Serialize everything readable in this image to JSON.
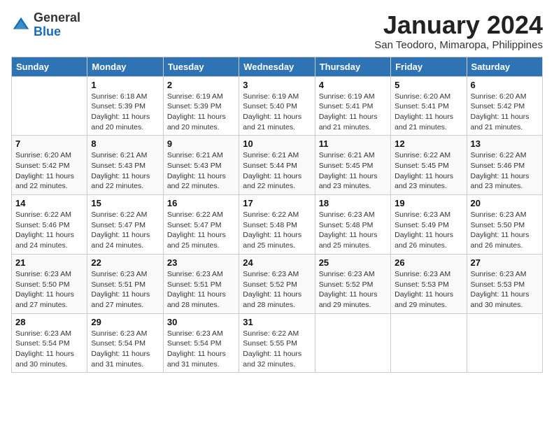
{
  "logo": {
    "general": "General",
    "blue": "Blue"
  },
  "title": "January 2024",
  "location": "San Teodoro, Mimaropa, Philippines",
  "days_header": [
    "Sunday",
    "Monday",
    "Tuesday",
    "Wednesday",
    "Thursday",
    "Friday",
    "Saturday"
  ],
  "weeks": [
    [
      {
        "num": "",
        "info": ""
      },
      {
        "num": "1",
        "info": "Sunrise: 6:18 AM\nSunset: 5:39 PM\nDaylight: 11 hours and 20 minutes."
      },
      {
        "num": "2",
        "info": "Sunrise: 6:19 AM\nSunset: 5:39 PM\nDaylight: 11 hours and 20 minutes."
      },
      {
        "num": "3",
        "info": "Sunrise: 6:19 AM\nSunset: 5:40 PM\nDaylight: 11 hours and 21 minutes."
      },
      {
        "num": "4",
        "info": "Sunrise: 6:19 AM\nSunset: 5:41 PM\nDaylight: 11 hours and 21 minutes."
      },
      {
        "num": "5",
        "info": "Sunrise: 6:20 AM\nSunset: 5:41 PM\nDaylight: 11 hours and 21 minutes."
      },
      {
        "num": "6",
        "info": "Sunrise: 6:20 AM\nSunset: 5:42 PM\nDaylight: 11 hours and 21 minutes."
      }
    ],
    [
      {
        "num": "7",
        "info": "Sunrise: 6:20 AM\nSunset: 5:42 PM\nDaylight: 11 hours and 22 minutes."
      },
      {
        "num": "8",
        "info": "Sunrise: 6:21 AM\nSunset: 5:43 PM\nDaylight: 11 hours and 22 minutes."
      },
      {
        "num": "9",
        "info": "Sunrise: 6:21 AM\nSunset: 5:43 PM\nDaylight: 11 hours and 22 minutes."
      },
      {
        "num": "10",
        "info": "Sunrise: 6:21 AM\nSunset: 5:44 PM\nDaylight: 11 hours and 22 minutes."
      },
      {
        "num": "11",
        "info": "Sunrise: 6:21 AM\nSunset: 5:45 PM\nDaylight: 11 hours and 23 minutes."
      },
      {
        "num": "12",
        "info": "Sunrise: 6:22 AM\nSunset: 5:45 PM\nDaylight: 11 hours and 23 minutes."
      },
      {
        "num": "13",
        "info": "Sunrise: 6:22 AM\nSunset: 5:46 PM\nDaylight: 11 hours and 23 minutes."
      }
    ],
    [
      {
        "num": "14",
        "info": "Sunrise: 6:22 AM\nSunset: 5:46 PM\nDaylight: 11 hours and 24 minutes."
      },
      {
        "num": "15",
        "info": "Sunrise: 6:22 AM\nSunset: 5:47 PM\nDaylight: 11 hours and 24 minutes."
      },
      {
        "num": "16",
        "info": "Sunrise: 6:22 AM\nSunset: 5:47 PM\nDaylight: 11 hours and 25 minutes."
      },
      {
        "num": "17",
        "info": "Sunrise: 6:22 AM\nSunset: 5:48 PM\nDaylight: 11 hours and 25 minutes."
      },
      {
        "num": "18",
        "info": "Sunrise: 6:23 AM\nSunset: 5:48 PM\nDaylight: 11 hours and 25 minutes."
      },
      {
        "num": "19",
        "info": "Sunrise: 6:23 AM\nSunset: 5:49 PM\nDaylight: 11 hours and 26 minutes."
      },
      {
        "num": "20",
        "info": "Sunrise: 6:23 AM\nSunset: 5:50 PM\nDaylight: 11 hours and 26 minutes."
      }
    ],
    [
      {
        "num": "21",
        "info": "Sunrise: 6:23 AM\nSunset: 5:50 PM\nDaylight: 11 hours and 27 minutes."
      },
      {
        "num": "22",
        "info": "Sunrise: 6:23 AM\nSunset: 5:51 PM\nDaylight: 11 hours and 27 minutes."
      },
      {
        "num": "23",
        "info": "Sunrise: 6:23 AM\nSunset: 5:51 PM\nDaylight: 11 hours and 28 minutes."
      },
      {
        "num": "24",
        "info": "Sunrise: 6:23 AM\nSunset: 5:52 PM\nDaylight: 11 hours and 28 minutes."
      },
      {
        "num": "25",
        "info": "Sunrise: 6:23 AM\nSunset: 5:52 PM\nDaylight: 11 hours and 29 minutes."
      },
      {
        "num": "26",
        "info": "Sunrise: 6:23 AM\nSunset: 5:53 PM\nDaylight: 11 hours and 29 minutes."
      },
      {
        "num": "27",
        "info": "Sunrise: 6:23 AM\nSunset: 5:53 PM\nDaylight: 11 hours and 30 minutes."
      }
    ],
    [
      {
        "num": "28",
        "info": "Sunrise: 6:23 AM\nSunset: 5:54 PM\nDaylight: 11 hours and 30 minutes."
      },
      {
        "num": "29",
        "info": "Sunrise: 6:23 AM\nSunset: 5:54 PM\nDaylight: 11 hours and 31 minutes."
      },
      {
        "num": "30",
        "info": "Sunrise: 6:23 AM\nSunset: 5:54 PM\nDaylight: 11 hours and 31 minutes."
      },
      {
        "num": "31",
        "info": "Sunrise: 6:22 AM\nSunset: 5:55 PM\nDaylight: 11 hours and 32 minutes."
      },
      {
        "num": "",
        "info": ""
      },
      {
        "num": "",
        "info": ""
      },
      {
        "num": "",
        "info": ""
      }
    ]
  ]
}
